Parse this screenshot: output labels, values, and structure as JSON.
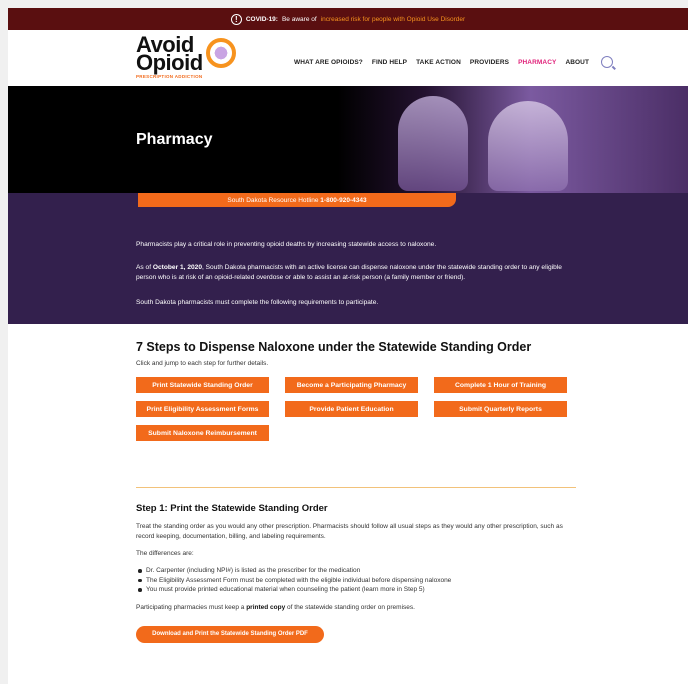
{
  "alert": {
    "prefix": "COVID-19:",
    "text": "Be aware of",
    "link": "increased risk for people with Opioid Use Disorder"
  },
  "logo": {
    "line1": "Avoid",
    "line2": "Opioid",
    "tagline": "PRESCRIPTION ADDICTION"
  },
  "nav": {
    "items": [
      "WHAT ARE OPIOIDS?",
      "FIND HELP",
      "TAKE ACTION",
      "PROVIDERS",
      "PHARMACY",
      "ABOUT"
    ],
    "active": "PHARMACY",
    "search_icon": "search-icon"
  },
  "hero": {
    "title": "Pharmacy"
  },
  "hotline": {
    "label": "South Dakota Resource Hotline",
    "number": "1-800-920-4343"
  },
  "intro": {
    "p1": "Pharmacists play a critical role in preventing opioid deaths by increasing statewide access to naloxone.",
    "p2_prefix": "As of",
    "p2_date": "October 1, 2020",
    "p2_rest": ", South Dakota pharmacists with an active license can dispense naloxone under the statewide standing order to any eligible person who is at risk of an opioid-related overdose or able to assist an at-risk person (a family member or friend).",
    "p3": "South Dakota pharmacists must complete the following requirements to participate."
  },
  "steps": {
    "heading": "7 Steps to Dispense Naloxone under the Statewide Standing Order",
    "subtext": "Click and jump to each step for further details.",
    "buttons": [
      "Print Statewide Standing Order",
      "Become a Participating Pharmacy",
      "Complete 1 Hour of Training",
      "Print Eligibility Assessment Forms",
      "Provide Patient Education",
      "Submit Quarterly Reports",
      "Submit Naloxone Reimbursement"
    ]
  },
  "step1": {
    "heading": "Step 1: Print the Statewide Standing Order",
    "p1": "Treat the standing order as you would any other prescription. Pharmacists should follow all usual steps as they would any other prescription, such as record keeping, documentation, billing, and labeling requirements.",
    "p2": "The differences are:",
    "bullets": [
      "Dr. Carpenter (including NPI#) is listed as the prescriber for the medication",
      "The Eligibility Assessment Form must be completed with the eligible individual before dispensing naloxone",
      "You must provide printed educational material when counseling the patient (learn more in Step 5)"
    ],
    "p3_prefix": "Participating pharmacies must keep a",
    "p3_bold": "printed copy",
    "p3_rest": "of the statewide standing order on premises.",
    "pdf_button": "Download and Print the Statewide Standing Order PDF"
  },
  "colors": {
    "orange": "#f26a1b",
    "purple": "#33204d",
    "alert_bg": "#5a0f10",
    "active_nav": "#e0227a"
  }
}
